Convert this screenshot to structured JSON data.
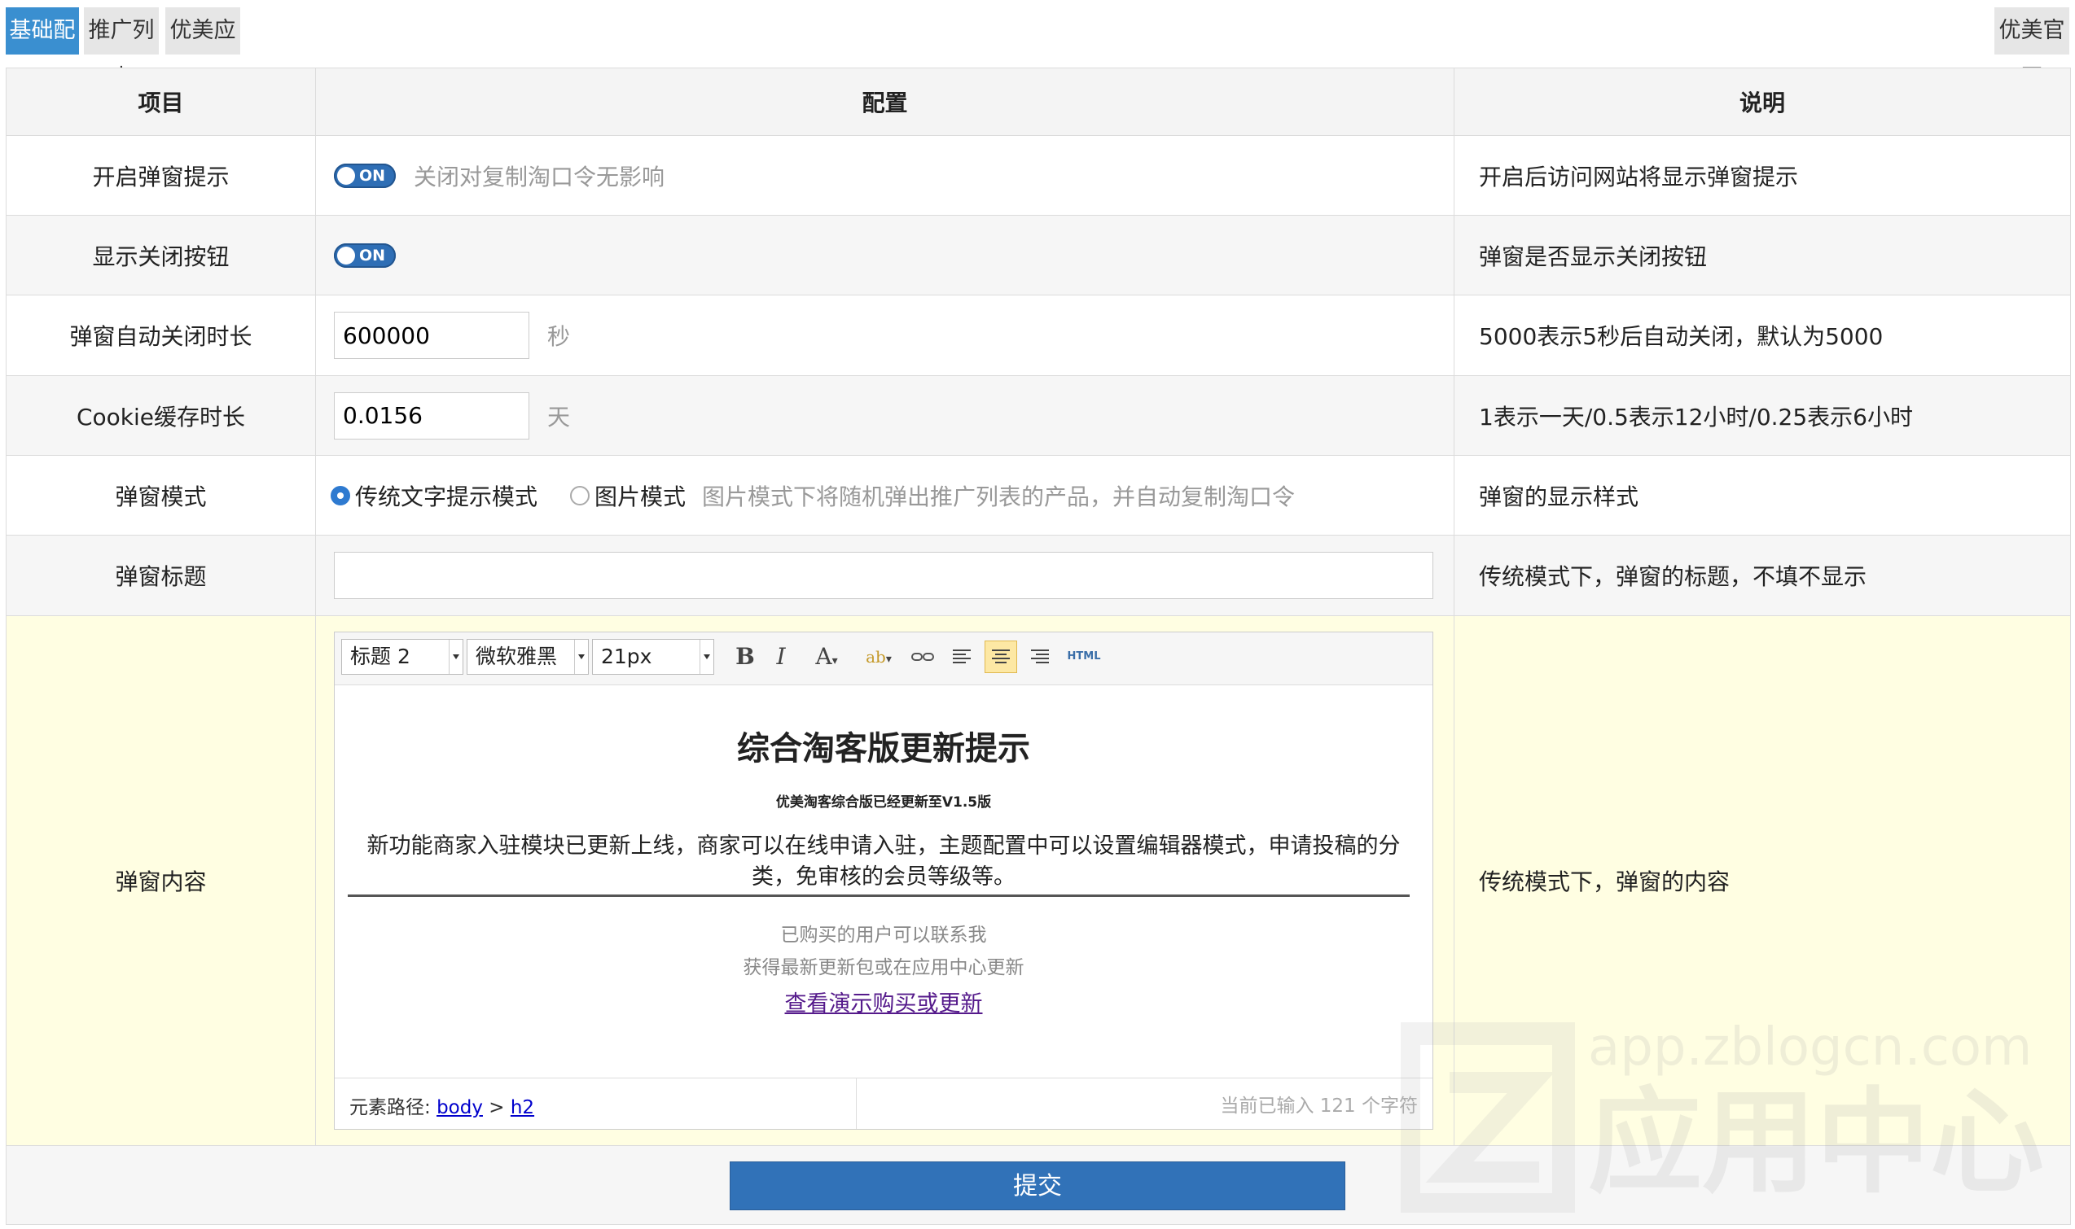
{
  "tabs": [
    {
      "label": "基础配置",
      "active": true
    },
    {
      "label": "推广列表",
      "active": false
    },
    {
      "label": "优美应用",
      "active": false
    }
  ],
  "official_site_label": "优美官网",
  "table": {
    "headers": [
      "项目",
      "配置",
      "说明"
    ],
    "rows": {
      "popup": {
        "label": "开启弹窗提示",
        "toggle": "ON",
        "hint": "关闭对复制淘口令无影响",
        "desc": "开启后访问网站将显示弹窗提示"
      },
      "close_button": {
        "label": "显示关闭按钮",
        "toggle": "ON",
        "desc": "弹窗是否显示关闭按钮"
      },
      "auto_close": {
        "label": "弹窗自动关闭时长",
        "value": "600000",
        "unit": "秒",
        "desc": "5000表示5秒后自动关闭，默认为5000"
      },
      "cookie": {
        "label": "Cookie缓存时长",
        "value": "0.0156",
        "unit": "天",
        "desc": "1表示一天/0.5表示12小时/0.25表示6小时"
      },
      "mode": {
        "label": "弹窗模式",
        "option1": "传统文字提示模式",
        "option2": "图片模式",
        "hint": "图片模式下将随机弹出推广列表的产品，并自动复制淘口令",
        "desc": "弹窗的显示样式",
        "selected": "option1"
      },
      "title": {
        "label": "弹窗标题",
        "value": "",
        "desc": "传统模式下，弹窗的标题，不填不显示"
      },
      "content": {
        "label": "弹窗内容",
        "desc": "传统模式下，弹窗的内容"
      }
    }
  },
  "editor": {
    "toolbar": {
      "format": "标题 2",
      "font": "微软雅黑",
      "size": "21px",
      "html_label": "HTML"
    },
    "content": {
      "heading": "综合淘客版更新提示",
      "subheading": "优美淘客综合版已经更新至V1.5版",
      "paragraph": "新功能商家入驻模块已更新上线，商家可以在线申请入驻，主题配置中可以设置编辑器模式，申请投稿的分类，免审核的会员等级等。",
      "line1": "已购买的用户可以联系我",
      "line2": "获得最新更新包或在应用中心更新",
      "link": "查看演示购买或更新"
    },
    "footer": {
      "path_label": "元素路径:",
      "path_body": "body",
      "path_sep": ">",
      "path_h2": "h2",
      "count": "当前已输入 121 个字符"
    }
  },
  "submit_label": "提交",
  "watermark": {
    "url": "app.zblogcn.com",
    "text": "应用中心"
  },
  "colors": {
    "accent": "#3a8fd0",
    "submit": "#3172b8",
    "toggle": "#2e6eb5",
    "content_row": "#fffee2"
  }
}
